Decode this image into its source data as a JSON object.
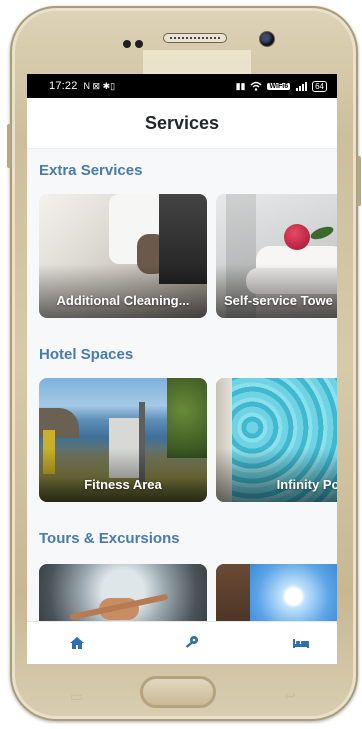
{
  "status_bar": {
    "time": "17:22",
    "left_icons": "N ⊠ ✱▯",
    "battery": "64",
    "wifi_badge": "WiFi6"
  },
  "header": {
    "title": "Services"
  },
  "sections": [
    {
      "title": "Extra Services",
      "cards": [
        {
          "label": "Additional Cleaning..."
        },
        {
          "label": "Self-service Towe"
        }
      ]
    },
    {
      "title": "Hotel Spaces",
      "cards": [
        {
          "label": "Fitness Area"
        },
        {
          "label": "Infinity Pool"
        }
      ]
    },
    {
      "title": "Tours & Excursions",
      "cards": [
        {
          "label": ""
        },
        {
          "label": ""
        }
      ]
    }
  ],
  "bottom_nav": [
    {
      "icon": "home-icon"
    },
    {
      "icon": "key-icon"
    },
    {
      "icon": "bed-icon"
    }
  ],
  "colors": {
    "accent": "#4a7ab0",
    "title": "#23262d",
    "nav_icon": "#2f6fb0",
    "frame_gold": "#cdbf9c"
  }
}
